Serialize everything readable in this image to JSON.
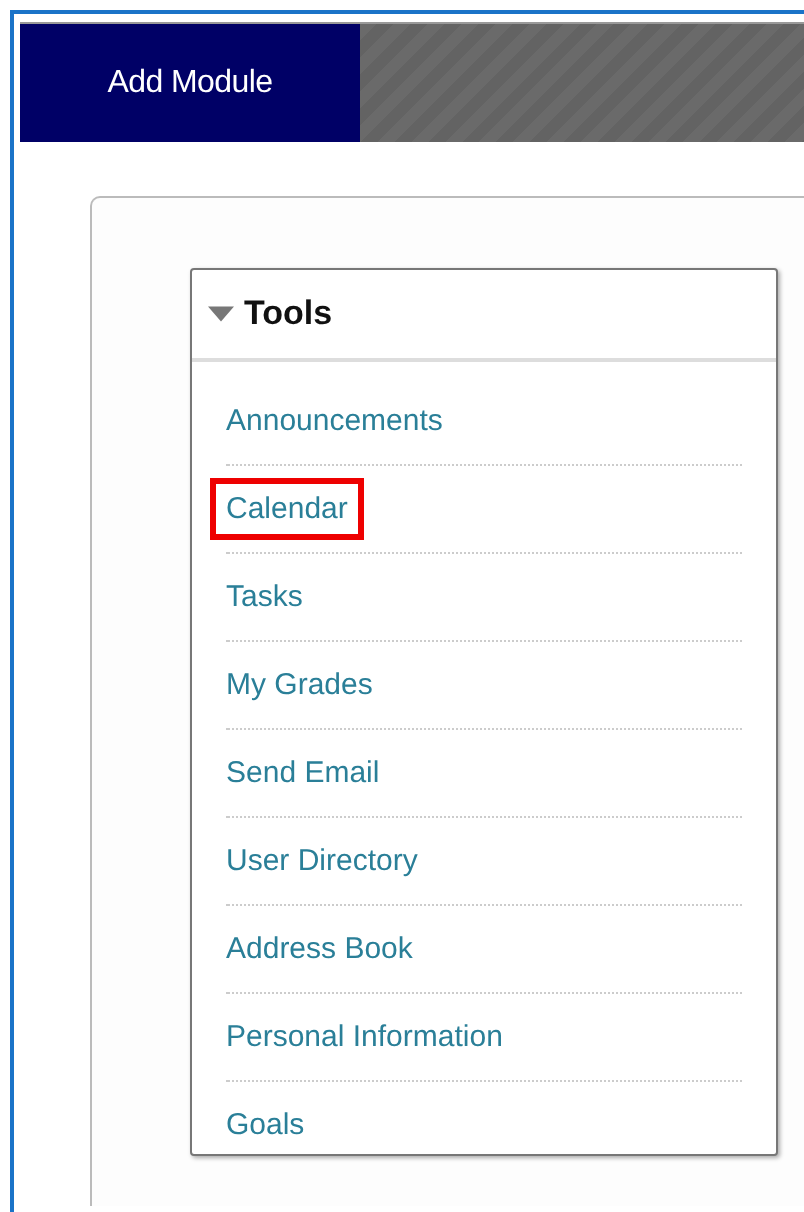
{
  "header": {
    "tab": "Add Module"
  },
  "module": {
    "title": "Tools",
    "expanded": true,
    "items": [
      {
        "label": "Announcements",
        "highlighted": false
      },
      {
        "label": "Calendar",
        "highlighted": true
      },
      {
        "label": "Tasks",
        "highlighted": false
      },
      {
        "label": "My Grades",
        "highlighted": false
      },
      {
        "label": "Send Email",
        "highlighted": false
      },
      {
        "label": "User Directory",
        "highlighted": false
      },
      {
        "label": "Address Book",
        "highlighted": false
      },
      {
        "label": "Personal Information",
        "highlighted": false
      },
      {
        "label": "Goals",
        "highlighted": false
      }
    ]
  }
}
